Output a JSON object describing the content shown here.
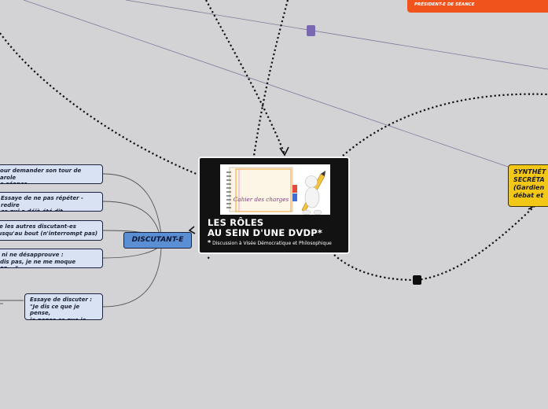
{
  "central": {
    "illustration_caption": "Cahier des charges",
    "title": "LES RÔLES\nAU SEIN D'UNE DVDP*",
    "footnote_star": "*",
    "footnote": "Discussion à Visée Démocratique et Philosophique"
  },
  "discutant": {
    "label": "DISCUTANT-E"
  },
  "discutant_children": [
    {
      "text": "pour demander son tour de parole\nde séance"
    },
    {
      "text": "Essaye de ne pas répéter - redire\nce qui a déjà été dit"
    },
    {
      "text": "se les autres discutant-es\njusqu'au bout (n'interrompt pas)"
    },
    {
      "text": "e ni ne désapprouve :\nudis pas, je ne me moque pas,...\""
    },
    {
      "text": "Essaye de discuter :\n\"Je dis ce que je pense,\nje pense ce que je dis\""
    }
  ],
  "synthese": {
    "text": "SYNTHÉT\nSECRÉTA\n(Gardien\ndébat et"
  },
  "top_right": {
    "text": "FONCTIONNE EN SYNERGIE AVEC LE-LA\nPRÉSIDENT-E DE SÉANCE"
  },
  "colors": {
    "background": "#d3d3d5",
    "central_fill": "#121212",
    "discutant_fill": "#5b8fd3",
    "leaf_fill": "#d9e2f2",
    "synth_fill": "#f2c716",
    "top_right_fill": "#f0541c",
    "marker_purple": "#7a68b3",
    "connector_line": "#807a9a"
  }
}
